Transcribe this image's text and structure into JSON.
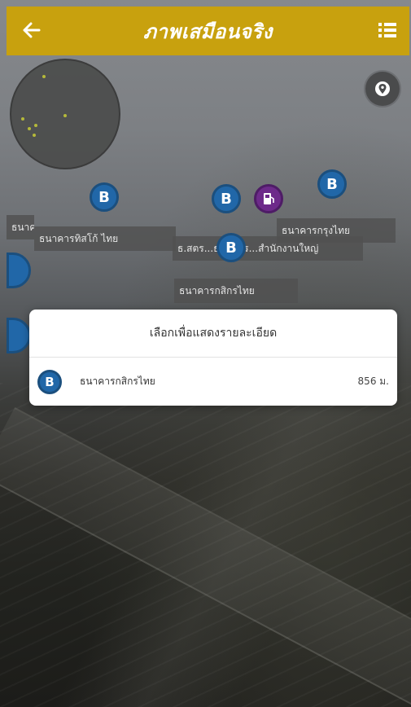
{
  "header": {
    "title": "ภาพเสมือนจริง",
    "back_icon": "arrow-left-icon",
    "menu_icon": "list-icon",
    "color": "#c8a10e"
  },
  "radar": {
    "label": "radar-minimap"
  },
  "location_button": {
    "icon": "location-pin-icon"
  },
  "markers": [
    {
      "glyph": "B",
      "type": "bank"
    },
    {
      "glyph": "B",
      "type": "bank"
    },
    {
      "glyph": "⛽",
      "type": "gas-station"
    },
    {
      "glyph": "B",
      "type": "bank"
    },
    {
      "glyph": "B",
      "type": "bank"
    }
  ],
  "labels": {
    "label_1": "ธนาคารทิสโก้ ไทย",
    "label_2": "ธนาคารทิสโก้ ไทย",
    "label_3": "ธ.สตร...ธนาคาร...สำนักงานใหญ่",
    "label_4": "ธนาคารกรุงไทย",
    "label_5": "ธนาคารกสิกรไทย"
  },
  "dialog": {
    "title": "เลือกเพื่อแสดงรายละเอียด",
    "items": [
      {
        "icon_glyph": "B",
        "name": "ธนาคารกสิกรไทย",
        "distance": "856 ม."
      }
    ]
  },
  "colors": {
    "bank_marker": "#2167a8",
    "gas_marker": "#6d2a8a"
  }
}
